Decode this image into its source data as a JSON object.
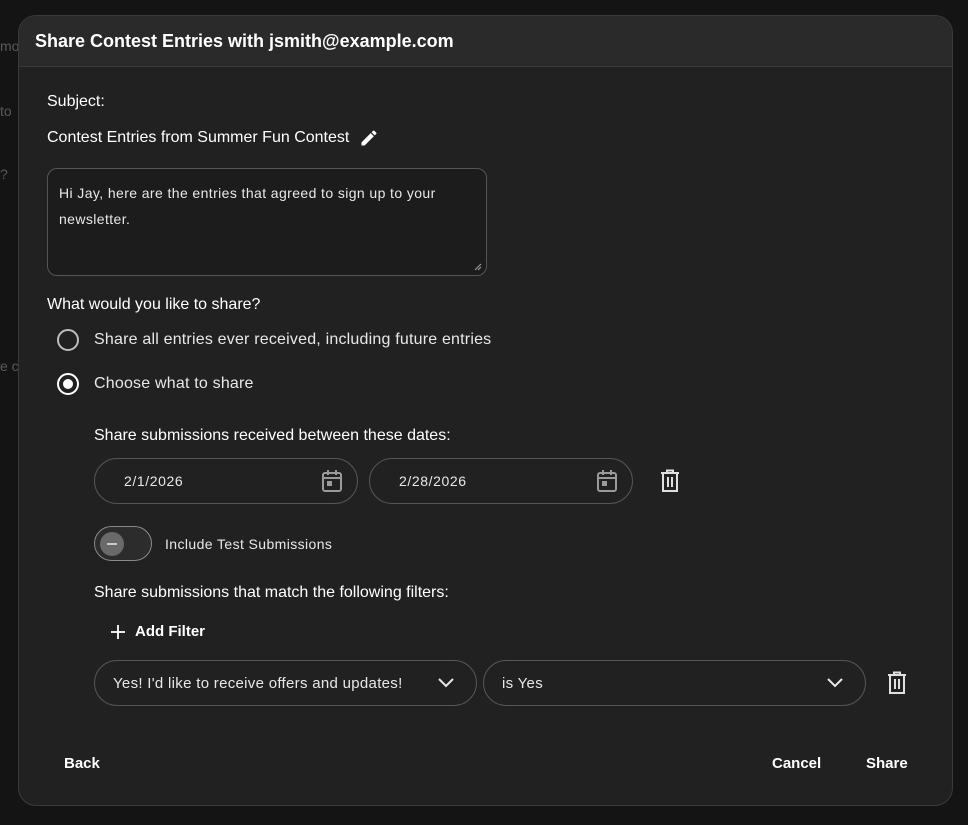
{
  "backdrop": {
    "fragments": [
      "mo",
      "to",
      "?",
      "e c"
    ]
  },
  "dialog": {
    "title": "Share Contest Entries with jsmith@example.com",
    "subject_label": "Subject:",
    "subject_value": "Contest Entries from Summer Fun Contest",
    "message": "Hi Jay, here are the entries that agreed to sign up to your newsletter.",
    "share_question": "What would you like to share?",
    "options": [
      {
        "label": "Share all entries ever received, including future entries",
        "selected": false
      },
      {
        "label": "Choose what to share",
        "selected": true
      }
    ],
    "dates_heading": "Share submissions received between these dates:",
    "start_date": "2/1/2026",
    "end_date": "2/28/2026",
    "include_test_label": "Include Test Submissions",
    "include_test_enabled": false,
    "filters_heading": "Share submissions that match the following filters:",
    "add_filter_label": "Add Filter",
    "filter": {
      "field": "Yes! I'd like to receive offers and updates!",
      "condition": "is Yes"
    },
    "footer": {
      "back": "Back",
      "cancel": "Cancel",
      "share": "Share"
    }
  },
  "icons": {
    "edit": "pencil-icon",
    "calendar": "calendar-icon",
    "delete": "trash-icon",
    "add": "plus-icon",
    "dropdown": "chevron-down-icon"
  },
  "colors": {
    "dialog_bg": "#212121",
    "header_bg": "#2a2a2a",
    "border": "#555555",
    "text": "#ffffff"
  }
}
